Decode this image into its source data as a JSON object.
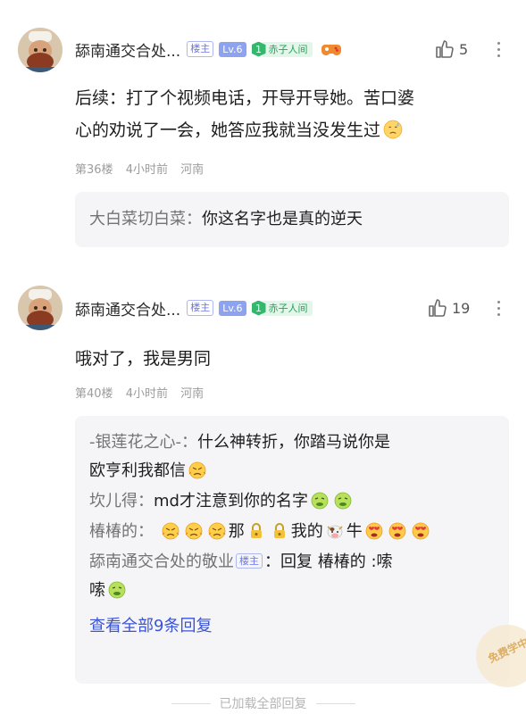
{
  "posts": [
    {
      "username": "舔南通交合处...",
      "badge_lz": "楼主",
      "level": "Lv.6",
      "honor_num": "1",
      "honor_text": "赤子人间",
      "likes": "5",
      "content_line1": "后续：打了个视频电话，开导开导她。苦口婆",
      "content_line2": "心的劝说了一会，她答应我就当没发生过",
      "floor": "第36楼",
      "time": "4小时前",
      "location": "河南",
      "replies": [
        {
          "name": "大白菜切白菜：",
          "text": "你这名字也是真的逆天"
        }
      ]
    },
    {
      "username": "舔南通交合处...",
      "badge_lz": "楼主",
      "level": "Lv.6",
      "honor_num": "1",
      "honor_text": "赤子人间",
      "likes": "19",
      "content_line1": "哦对了，我是男同",
      "floor": "第40楼",
      "time": "4小时前",
      "location": "河南",
      "replies": [
        {
          "name": "-银莲花之心-：",
          "text_l1": "什么神转折，你踏马说你是",
          "text_l2": "欧亨利我都信"
        },
        {
          "name": "坎儿得：",
          "text": "md才注意到你的名字"
        },
        {
          "name": "椿椿的：",
          "text_a": "那",
          "text_b": "我的",
          "text_c": "牛"
        },
        {
          "name": "舔南通交合处的敬业",
          "badge": "楼主",
          "text_l1": "：回复 椿椿的 :嗦",
          "text_l2": "嗦"
        }
      ],
      "view_all": "查看全部9条回复"
    }
  ],
  "footer": "已加载全部回复",
  "watermark": "免费学中",
  "colors": {
    "link_blue": "#3a53d7",
    "honor_green": "#35b86d",
    "level_blue": "#8ea3ef",
    "reply_bg": "#f5f5f7"
  },
  "icons": [
    "avatar-chef",
    "thumbs-up-icon",
    "more-icon",
    "game-controller-icon",
    "emoji-sweat-icon",
    "emoji-nauseated-icon",
    "emoji-angry-icon",
    "lock-icon",
    "cow-icon",
    "emoji-heart-eyes-icon"
  ]
}
